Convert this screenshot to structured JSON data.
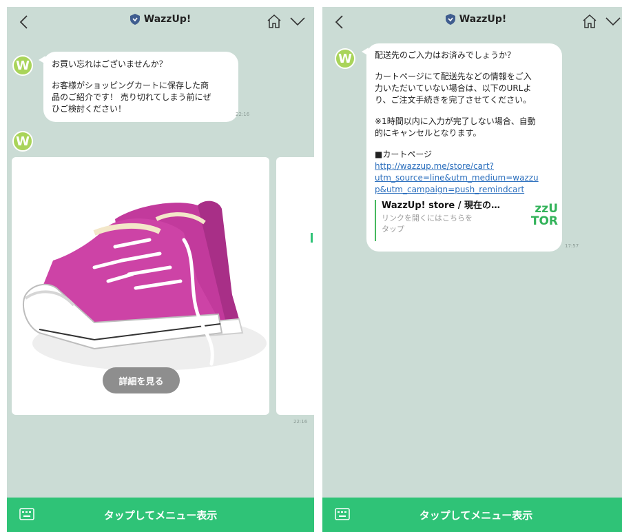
{
  "header": {
    "title": "WazzUp!"
  },
  "avatar_letter": "W",
  "left": {
    "message": {
      "line1": "お買い忘れはございませんか？",
      "line2": "お客様がショッピングカートに保存した商",
      "line3": "品のご紹介です！ 売り切れてしまう前にぜ",
      "line4": "ひご検討ください！",
      "time": "22:16"
    },
    "card": {
      "button_label": "詳細を見る",
      "time": "22:16"
    }
  },
  "right": {
    "message": {
      "line1": "配送先のご入力はお済みでしょうか？",
      "line2": "カートページにて配送先などの情報をご入",
      "line3": "力いただいていない場合は、以下のURLよ",
      "line4": "り、ご注文手続きを完了させてください。",
      "line5": "※1時間以内に入力が完了しない場合、自動",
      "line6": "的にキャンセルとなります。",
      "line7": "■カートページ",
      "link1": "http://wazzup.me/store/cart?",
      "link2": "utm_source=line&utm_medium=wazzu",
      "link3": "p&utm_campaign=push_remindcart",
      "preview_title": "WazzUp! store / 現在の…",
      "preview_desc1": "リンクを開くにはこちらを",
      "preview_desc2": "タップ",
      "thumb1": "zzU",
      "thumb2": "TOR",
      "time": "17:57"
    }
  },
  "menu": {
    "label": "タップしてメニュー表示"
  },
  "colors": {
    "background": "#cbdcd5",
    "menu_bar": "#2fc377",
    "avatar": "#a9d45a",
    "link": "#2a6ebd",
    "shoe": "#c23a9c"
  }
}
